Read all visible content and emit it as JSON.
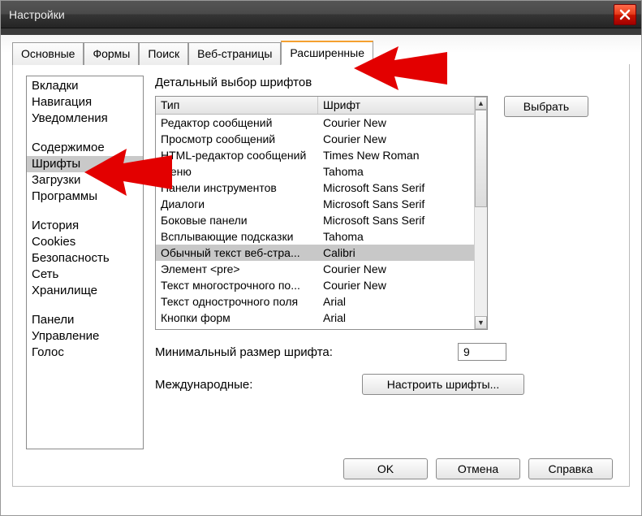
{
  "window": {
    "title": "Настройки"
  },
  "tabs": [
    {
      "label": "Основные"
    },
    {
      "label": "Формы"
    },
    {
      "label": "Поиск"
    },
    {
      "label": "Веб-страницы"
    },
    {
      "label": "Расширенные",
      "active": true
    }
  ],
  "sidebar": {
    "groups": [
      [
        "Вкладки",
        "Навигация",
        "Уведомления"
      ],
      [
        "Содержимое",
        "Шрифты",
        "Загрузки",
        "Программы"
      ],
      [
        "История",
        "Cookies",
        "Безопасность",
        "Сеть",
        "Хранилище"
      ],
      [
        "Панели",
        "Управление",
        "Голос"
      ]
    ],
    "selected": "Шрифты"
  },
  "main": {
    "section_title": "Детальный выбор шрифтов",
    "columns": {
      "type": "Тип",
      "font": "Шрифт"
    },
    "rows": [
      {
        "type": "Редактор сообщений",
        "font": "Courier New"
      },
      {
        "type": "Просмотр сообщений",
        "font": "Courier New"
      },
      {
        "type": "HTML-редактор сообщений",
        "font": "Times New Roman"
      },
      {
        "type": "Меню",
        "font": "Tahoma"
      },
      {
        "type": "Панели инструментов",
        "font": "Microsoft Sans Serif"
      },
      {
        "type": "Диалоги",
        "font": "Microsoft Sans Serif"
      },
      {
        "type": "Боковые панели",
        "font": "Microsoft Sans Serif"
      },
      {
        "type": "Всплывающие подсказки",
        "font": "Tahoma"
      },
      {
        "type": "Обычный текст веб-стра...",
        "font": "Calibri",
        "selected": true
      },
      {
        "type": "Элемент <pre>",
        "font": "Courier New"
      },
      {
        "type": "Текст многострочного по...",
        "font": "Courier New"
      },
      {
        "type": "Текст однострочного поля",
        "font": "Arial"
      },
      {
        "type": "Кнопки форм",
        "font": "Arial"
      }
    ],
    "select_button": "Выбрать",
    "min_size_label": "Минимальный размер шрифта:",
    "min_size_value": "9",
    "intl_label": "Международные:",
    "configure_fonts": "Настроить шрифты..."
  },
  "buttons": {
    "ok": "OK",
    "cancel": "Отмена",
    "help": "Справка"
  }
}
